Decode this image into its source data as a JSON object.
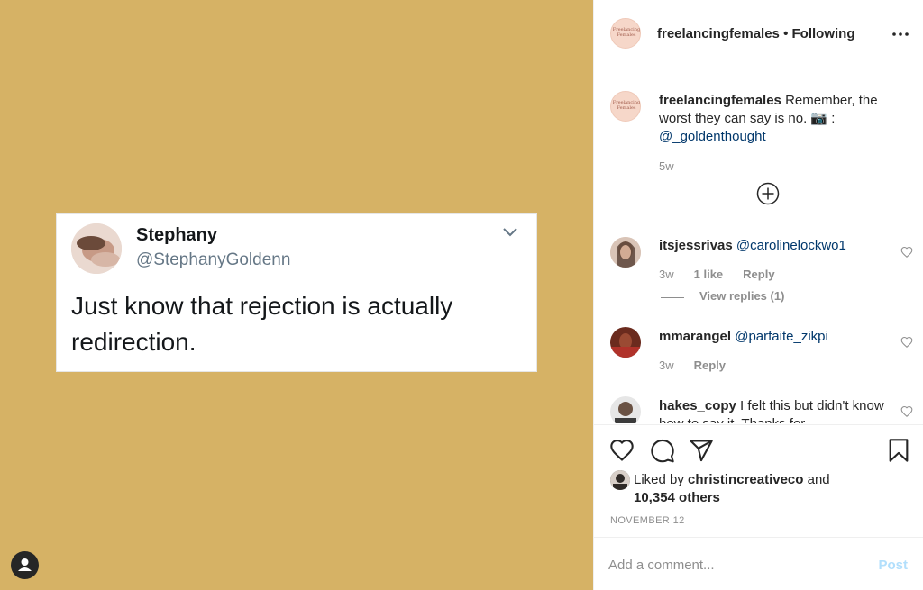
{
  "tweet": {
    "name": "Stephany",
    "handle": "@StephanyGoldenn",
    "text": "Just know that rejection is actually redirection."
  },
  "logo": {
    "text": "Freelancing Females"
  },
  "header": {
    "username": "freelancingfemales",
    "separator": " • ",
    "follow_status": "Following"
  },
  "caption": {
    "username": "freelancingfemales",
    "text": " Remember, the worst they can say is no. 📷 : ",
    "mention": "@_goldenthought",
    "time": "5w"
  },
  "comments": [
    {
      "username": "itsjessrivas",
      "mention": "@carolinelockwo1",
      "text": "",
      "time": "3w",
      "likes": "1 like",
      "reply": "Reply",
      "view_replies": "View replies (1)"
    },
    {
      "username": "mmarangel",
      "mention": "@parfaite_zikpi",
      "text": "",
      "time": "3w",
      "reply": "Reply"
    },
    {
      "username": "hakes_copy",
      "mention": "",
      "text": " I felt this but didn't know how to say it. Thanks for",
      "time": "",
      "reply": ""
    }
  ],
  "likes": {
    "prefix": "Liked by ",
    "user": "christincreativeco",
    "middle": " and",
    "others": "10,354 others"
  },
  "date": "NOVEMBER 12",
  "add_comment": {
    "placeholder": "Add a comment...",
    "post_label": "Post"
  },
  "colors": {
    "media_background": "#d6b265",
    "link": "#00376b",
    "post_disabled": "#b2dffc"
  }
}
